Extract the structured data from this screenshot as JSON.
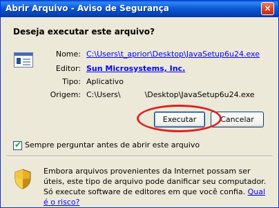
{
  "window": {
    "title": "Abrir Arquivo - Aviso de Segurança",
    "close_glyph": "×"
  },
  "dialog": {
    "question": "Deseja executar este arquivo?",
    "fields": {
      "name_label": "Nome:",
      "name_value": "C:\\Users\\t_aprior\\Desktop\\JavaSetup6u24.exe",
      "publisher_label": "Editor:",
      "publisher_value": "Sun Microsystems, Inc.",
      "type_label": "Tipo:",
      "type_value": "Aplicativo",
      "origin_label": "Origem:",
      "origin_value": "C:\\Users\\          \\Desktop\\JavaSetup6u24.exe"
    },
    "buttons": {
      "run": "Executar",
      "cancel": "Cancelar"
    },
    "checkbox": {
      "label": "Sempre perguntar antes de abrir este arquivo",
      "checked": true
    },
    "warning": {
      "text": "Embora arquivos provenientes da Internet possam ser úteis, este tipo de arquivo pode danificar seu computador. Só execute software de editores em que você confia.",
      "link": "Qual é o risco?"
    }
  },
  "icons": {
    "file": "application-file-icon",
    "shield": "security-shield-icon",
    "check": "checkmark-icon"
  },
  "colors": {
    "titlebar": "#0a5fd8",
    "dialog_bg": "#ece9d8",
    "link": "#0000ff",
    "highlight_ring": "#e02020",
    "close_button": "#d5422a"
  }
}
